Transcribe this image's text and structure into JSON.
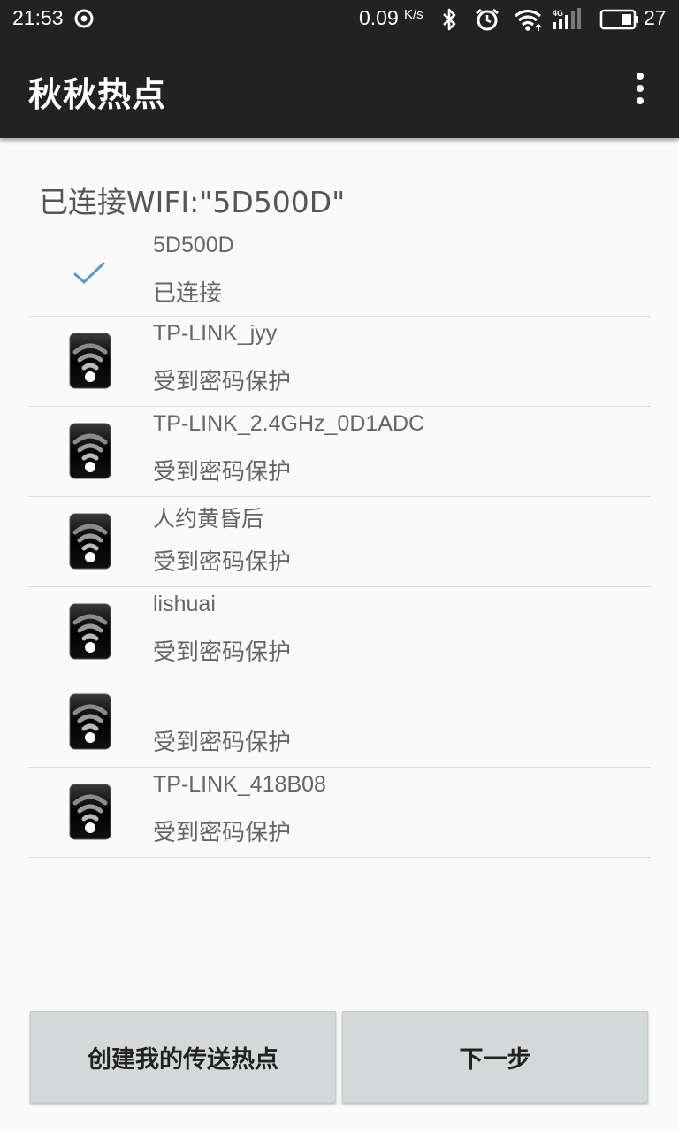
{
  "status_bar": {
    "time": "21:53",
    "net_speed": "0.09",
    "net_unit": "K/s",
    "network_type": "4G",
    "battery": "27",
    "icons": [
      "notification-icon",
      "bluetooth-icon",
      "alarm-icon",
      "wifi-signal-icon",
      "cell-signal-icon",
      "battery-icon"
    ]
  },
  "app_bar": {
    "title": "秋秋热点",
    "menu_icon": "overflow-menu-icon"
  },
  "connected_header": "已连接WIFI:\"5D500D\"",
  "networks": [
    {
      "ssid": "5D500D",
      "status": "已连接",
      "icon": "check-icon"
    },
    {
      "ssid": "TP-LINK_jyy",
      "status": "受到密码保护",
      "icon": "wifi-locked-icon"
    },
    {
      "ssid": "TP-LINK_2.4GHz_0D1ADC",
      "status": "受到密码保护",
      "icon": "wifi-locked-icon"
    },
    {
      "ssid": "人约黄昏后",
      "status": "受到密码保护",
      "icon": "wifi-locked-icon"
    },
    {
      "ssid": "lishuai",
      "status": "受到密码保护",
      "icon": "wifi-locked-icon"
    },
    {
      "ssid": "",
      "status": "受到密码保护",
      "icon": "wifi-locked-icon"
    },
    {
      "ssid": "TP-LINK_418B08",
      "status": "受到密码保护",
      "icon": "wifi-locked-icon"
    }
  ],
  "buttons": {
    "create_hotspot": "创建我的传送热点",
    "next": "下一步"
  },
  "colors": {
    "app_bar": "#222222",
    "background": "#fafafa",
    "check": "#5b9bc8",
    "button": "#d5d8d9"
  }
}
